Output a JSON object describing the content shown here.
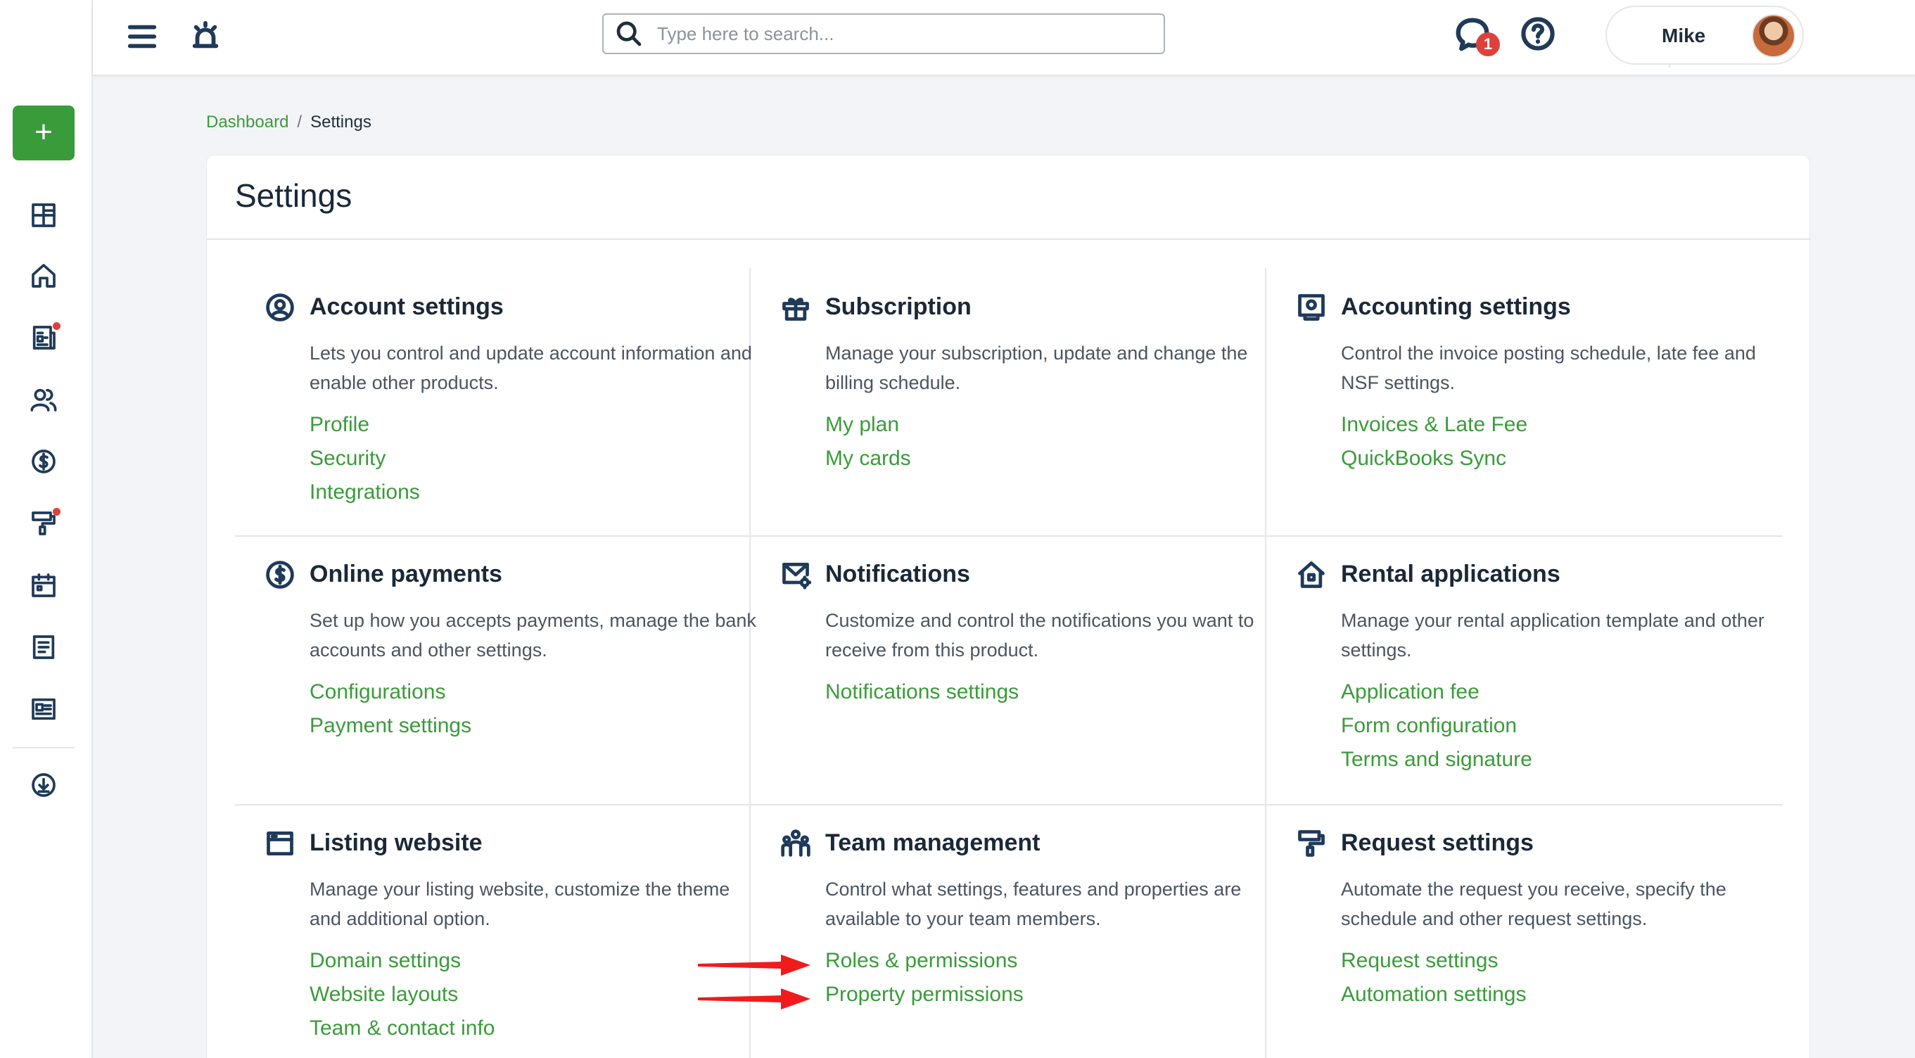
{
  "topbar": {
    "search_placeholder": "Type here to search...",
    "chat_badge": "1",
    "user_name": "Mike"
  },
  "breadcrumb": {
    "parent": "Dashboard",
    "separator": "/",
    "current": "Settings"
  },
  "sidebar": {
    "add_label": "+",
    "items": [
      {
        "icon": "dashboard-icon"
      },
      {
        "icon": "home-icon"
      },
      {
        "icon": "leases-icon",
        "dot": true
      },
      {
        "icon": "people-icon"
      },
      {
        "icon": "dollar-icon"
      },
      {
        "icon": "maintenance-icon",
        "dot": true
      },
      {
        "icon": "calendar-icon"
      },
      {
        "icon": "document-icon"
      },
      {
        "icon": "listing-icon"
      },
      {
        "icon": "download-icon"
      }
    ]
  },
  "page": {
    "title": "Settings",
    "sections": [
      {
        "title": "Account settings",
        "icon": "user-circle-icon",
        "description": "Lets you control and update account information and enable other products.",
        "links": [
          "Profile",
          "Security",
          "Integrations"
        ]
      },
      {
        "title": "Subscription",
        "icon": "gift-icon",
        "description": "Manage your subscription, update and change the billing schedule.",
        "links": [
          "My plan",
          "My cards"
        ]
      },
      {
        "title": "Accounting settings",
        "icon": "accounting-icon",
        "description": "Control the invoice posting schedule, late fee and NSF settings.",
        "links": [
          "Invoices & Late Fee",
          "QuickBooks Sync"
        ]
      },
      {
        "title": "Online payments",
        "icon": "dollar-circle-icon",
        "description": "Set up how you accepts payments, manage the bank accounts and other settings.",
        "links": [
          "Configurations",
          "Payment settings"
        ]
      },
      {
        "title": "Notifications",
        "icon": "mail-gear-icon",
        "description": "Customize and control the notifications you want to receive from this product.",
        "links": [
          "Notifications settings"
        ]
      },
      {
        "title": "Rental applications",
        "icon": "house-icon",
        "description": "Manage your rental application template and other settings.",
        "links": [
          "Application fee",
          "Form configuration",
          "Terms and signature"
        ]
      },
      {
        "title": "Listing website",
        "icon": "browser-icon",
        "description": "Manage your listing website, customize the theme and additional option.",
        "links": [
          "Domain settings",
          "Website layouts",
          "Team & contact info"
        ]
      },
      {
        "title": "Team management",
        "icon": "team-icon",
        "description": "Control what settings, features and properties are available to your team members.",
        "links": [
          "Roles & permissions",
          "Property permissions"
        ]
      },
      {
        "title": "Request settings",
        "icon": "paint-roller-icon",
        "description": "Automate the request you receive, specify the schedule and other request settings.",
        "links": [
          "Request settings",
          "Automation settings"
        ]
      }
    ]
  },
  "colors": {
    "accent_green": "#3a9b3a",
    "alert_red": "#e0403a",
    "annotation_arrow": "#ee1c1c"
  }
}
